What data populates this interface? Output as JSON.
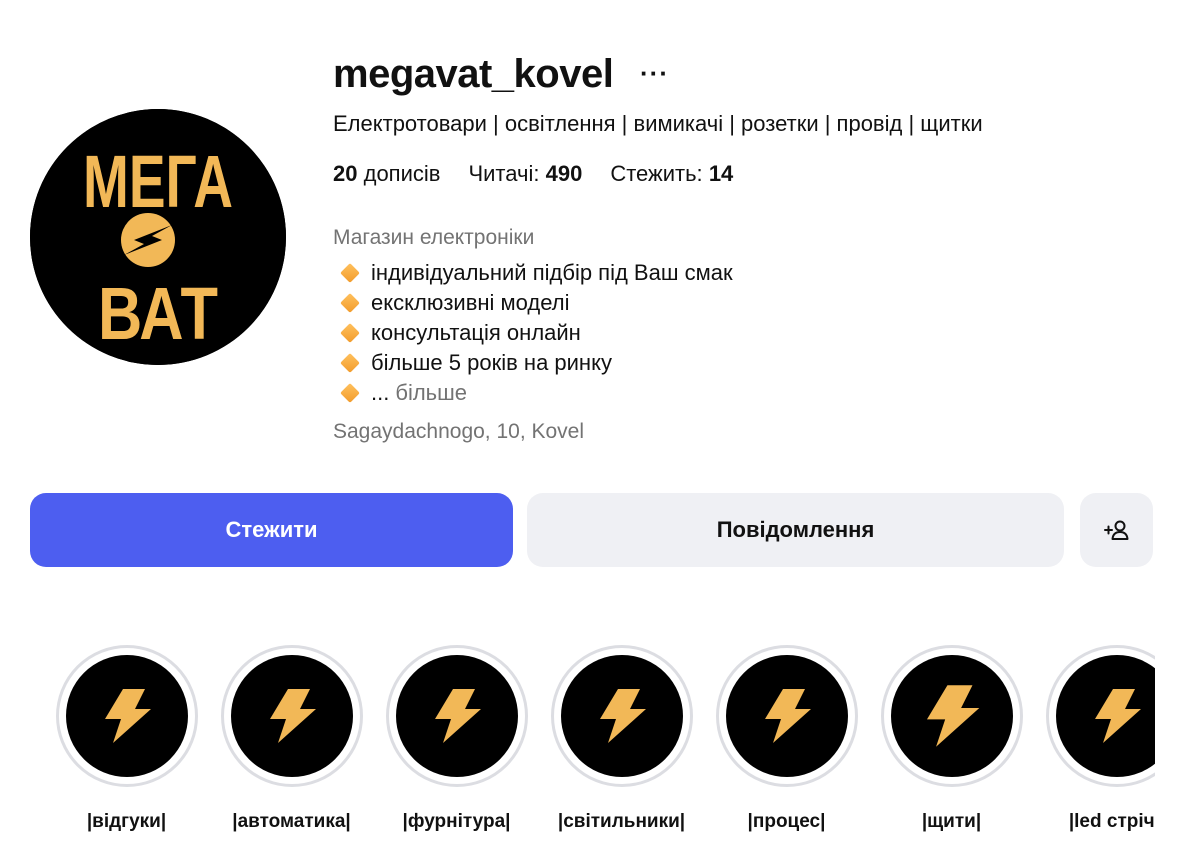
{
  "profile": {
    "username": "megavat_kovel",
    "more_label": "···",
    "category": "Електротовари | освітлення | вимикачі | розетки | провід | щитки",
    "avatar_text": {
      "top": "МЕГА",
      "bottom": "ВАТ"
    },
    "stats": {
      "posts_count": "20",
      "posts_label": "дописів",
      "followers_label": "Читачі:",
      "followers_count": "490",
      "following_label": "Стежить:",
      "following_count": "14"
    },
    "bio_label": "Магазин електроніки",
    "bio_lines": [
      "індивідуальний підбір під Ваш смак",
      "ексклюзивні моделі",
      "консультація онлайн",
      "більше 5 років на ринку"
    ],
    "bio_ellipsis": "...",
    "bio_more": "більше",
    "address": "Sagaydachnogo, 10, Kovel"
  },
  "actions": {
    "follow": "Стежити",
    "message": "Повідомлення",
    "add_user_icon": "person-add-icon"
  },
  "highlights": [
    {
      "label": "|відгуки|"
    },
    {
      "label": "|автоматика|"
    },
    {
      "label": "|фурнітура|"
    },
    {
      "label": "|світильники|"
    },
    {
      "label": "|процес|"
    },
    {
      "label": "|щити|"
    },
    {
      "label": "|led стрічк"
    }
  ],
  "colors": {
    "accent": "#4d5ef0",
    "brand_gold": "#f2b857",
    "muted_text": "#737373",
    "button_bg": "#eff0f4",
    "diamond": "#f6a53a"
  }
}
